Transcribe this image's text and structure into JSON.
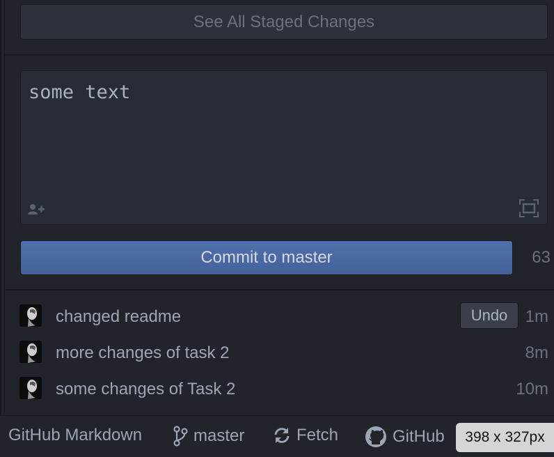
{
  "staged": {
    "see_all_label": "See All Staged Changes"
  },
  "editor": {
    "text": "some text"
  },
  "commit": {
    "button_label": "Commit to master",
    "char_count": "63"
  },
  "recent_commits": [
    {
      "message": "changed readme",
      "time": "1m",
      "undo_label": "Undo"
    },
    {
      "message": "more changes of task 2",
      "time": "8m"
    },
    {
      "message": "some changes of Task 2",
      "time": "10m"
    }
  ],
  "status_bar": {
    "grammar": "GitHub Markdown",
    "branch": "master",
    "fetch": "Fetch",
    "github": "GitHub",
    "size_badge": "398 x 327px"
  },
  "icons": {
    "coauthor": "person-add-icon",
    "expand": "expand-icon",
    "branch": "git-branch-icon",
    "fetch": "sync-icon",
    "github": "github-octocat-icon"
  },
  "colors": {
    "commit_button": "#4d6eaa",
    "background": "#21252b",
    "editor_background": "#282c34"
  }
}
